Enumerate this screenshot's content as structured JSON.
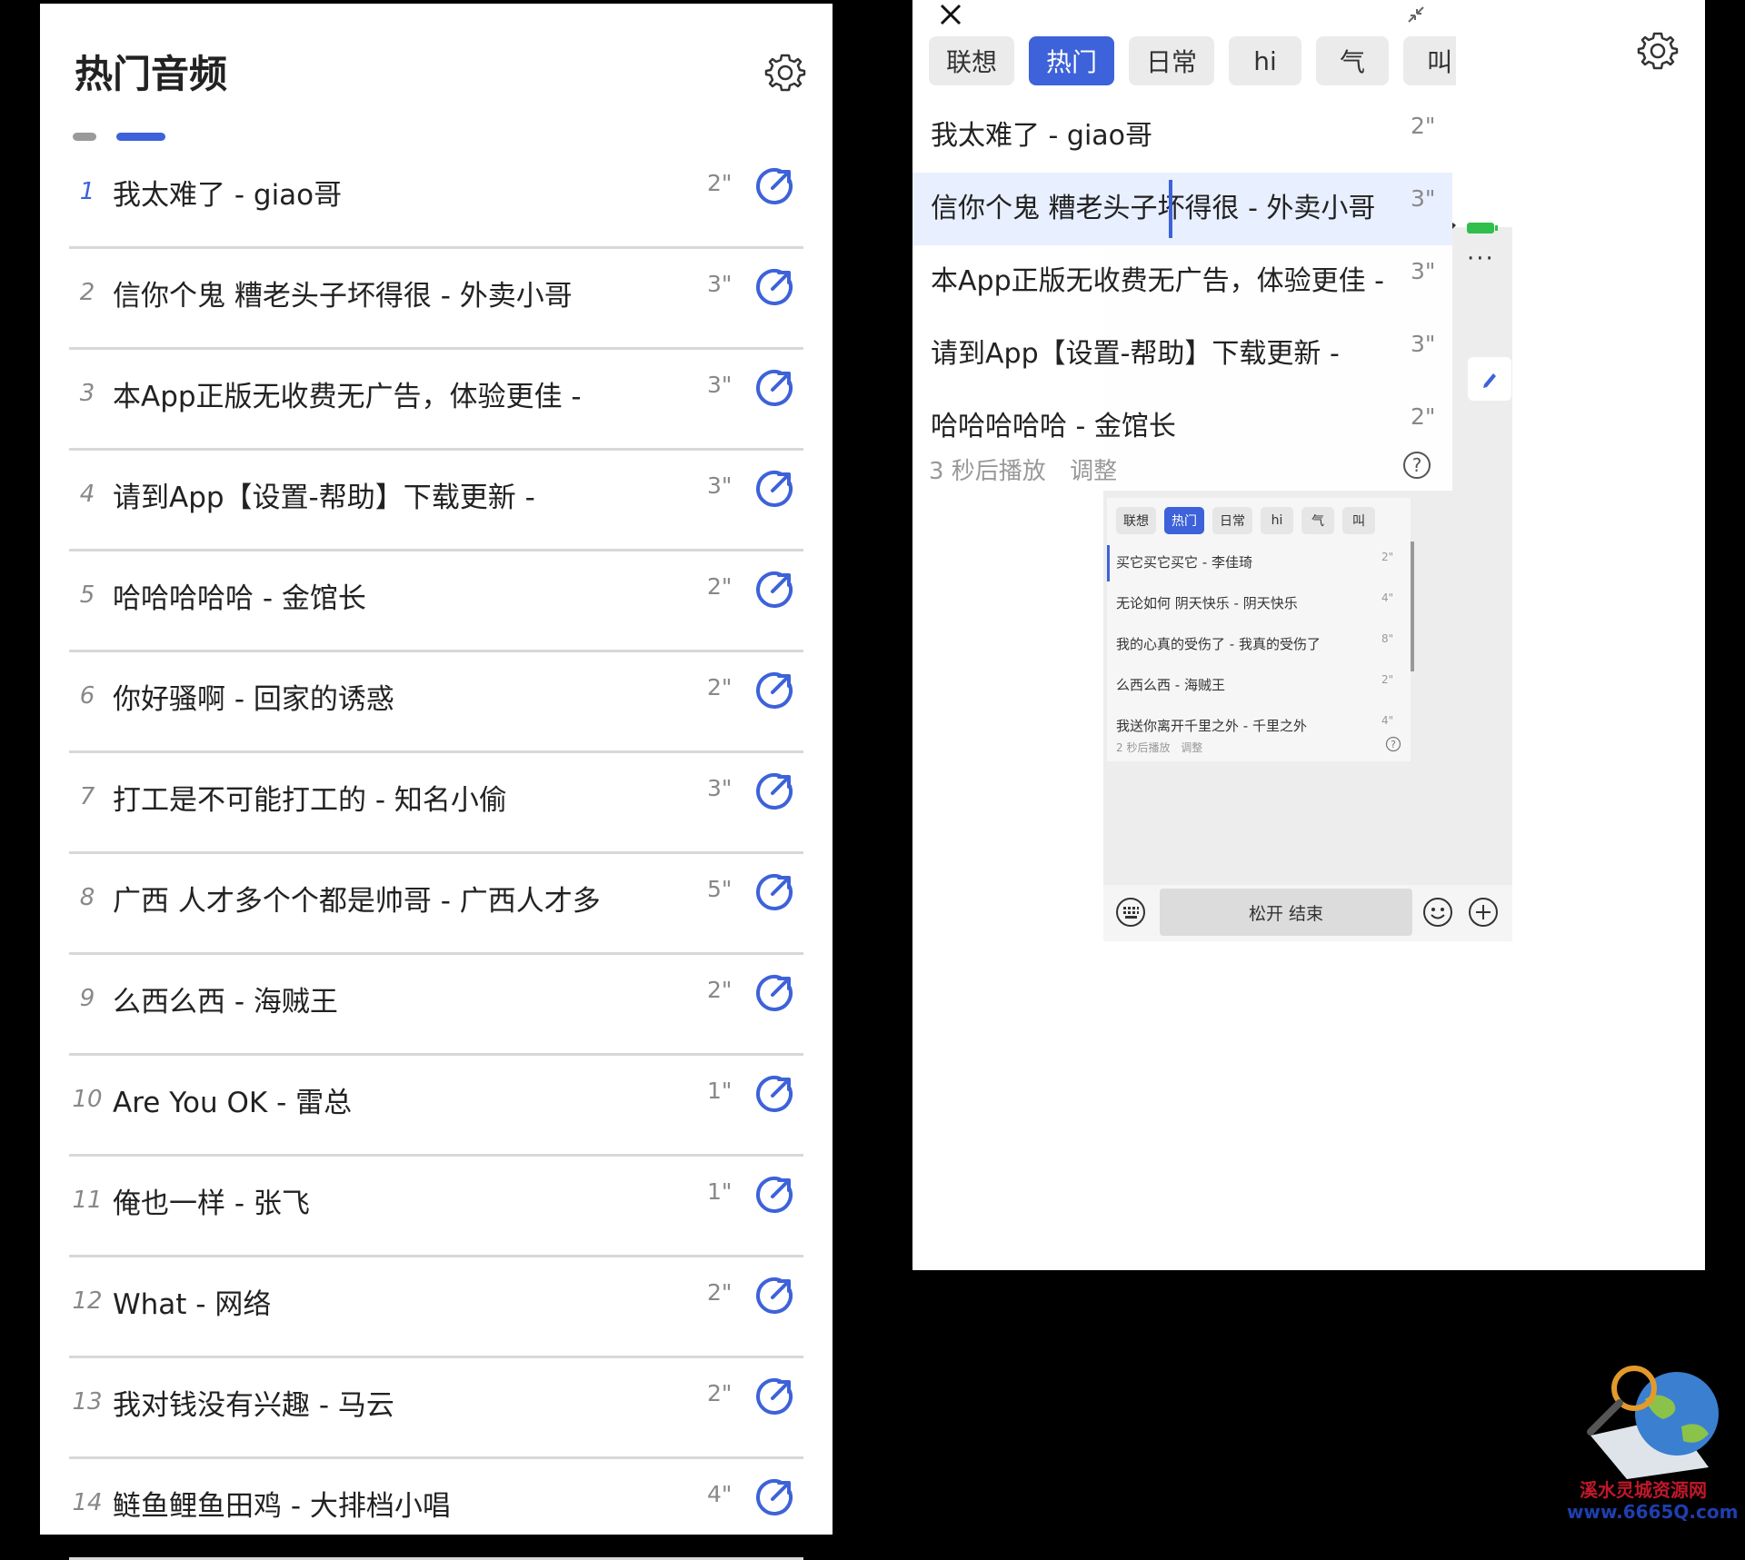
{
  "left": {
    "title": "热门音频",
    "items": [
      {
        "num": "1",
        "label": "我太难了 - giao哥",
        "dur": "2\""
      },
      {
        "num": "2",
        "label": "信你个鬼 糟老头子坏得很 - 外卖小哥",
        "dur": "3\""
      },
      {
        "num": "3",
        "label": "本App正版无收费无广告，体验更佳 -",
        "dur": "3\""
      },
      {
        "num": "4",
        "label": "请到App【设置-帮助】下载更新 -",
        "dur": "3\""
      },
      {
        "num": "5",
        "label": "哈哈哈哈哈 - 金馆长",
        "dur": "2\""
      },
      {
        "num": "6",
        "label": "你好骚啊 - 回家的诱惑",
        "dur": "2\""
      },
      {
        "num": "7",
        "label": "打工是不可能打工的 - 知名小偷",
        "dur": "3\""
      },
      {
        "num": "8",
        "label": "广西 人才多个个都是帅哥 - 广西人才多",
        "dur": "5\""
      },
      {
        "num": "9",
        "label": "么西么西 - 海贼王",
        "dur": "2\""
      },
      {
        "num": "10",
        "label": "Are You OK - 雷总",
        "dur": "1\""
      },
      {
        "num": "11",
        "label": "俺也一样 - 张飞",
        "dur": "1\""
      },
      {
        "num": "12",
        "label": "What - 网络",
        "dur": "2\""
      },
      {
        "num": "13",
        "label": "我对钱没有兴趣 - 马云",
        "dur": "2\""
      },
      {
        "num": "14",
        "label": "鲢鱼鲤鱼田鸡 - 大排档小唱",
        "dur": "4\""
      }
    ]
  },
  "right": {
    "tabs": [
      "联想",
      "热门",
      "日常",
      "hi",
      "气",
      "叫"
    ],
    "active_tab": "热门",
    "items": [
      {
        "label": "我太难了 - giao哥",
        "dur": "2\""
      },
      {
        "label": "信你个鬼 糟老头子坏得很 - 外卖小哥",
        "dur": "3\""
      },
      {
        "label": "本App正版无收费无广告，体验更佳 -",
        "dur": "3\""
      },
      {
        "label": "请到App【设置-帮助】下载更新 -",
        "dur": "3\""
      },
      {
        "label": "哈哈哈哈哈 - 金馆长",
        "dur": "2\""
      }
    ],
    "footer": {
      "countdown": "3 秒后播放",
      "adjust": "调整"
    },
    "preview": {
      "more": "···",
      "hold_button": "松开 结束",
      "mini": {
        "tabs": [
          "联想",
          "热门",
          "日常",
          "hi",
          "气",
          "叫"
        ],
        "items": [
          {
            "label": "买它买它买它 - 李佳琦",
            "dur": "2\""
          },
          {
            "label": "无论如何 阴天快乐 - 阴天快乐",
            "dur": "4\""
          },
          {
            "label": "我的心真的受伤了 - 我真的受伤了",
            "dur": "8\""
          },
          {
            "label": "么西么西 - 海贼王",
            "dur": "2\""
          },
          {
            "label": "我送你离开千里之外 - 千里之外",
            "dur": "4\""
          }
        ],
        "footer": {
          "countdown": "2 秒后播放",
          "adjust": "调整"
        }
      }
    }
  },
  "watermark": {
    "name": "溪水灵城资源网",
    "url": "www.6665Q.com"
  },
  "colors": {
    "accent": "#3d62d9",
    "divider": "#d8d8d8",
    "muted": "#888888",
    "background": "#000000"
  }
}
